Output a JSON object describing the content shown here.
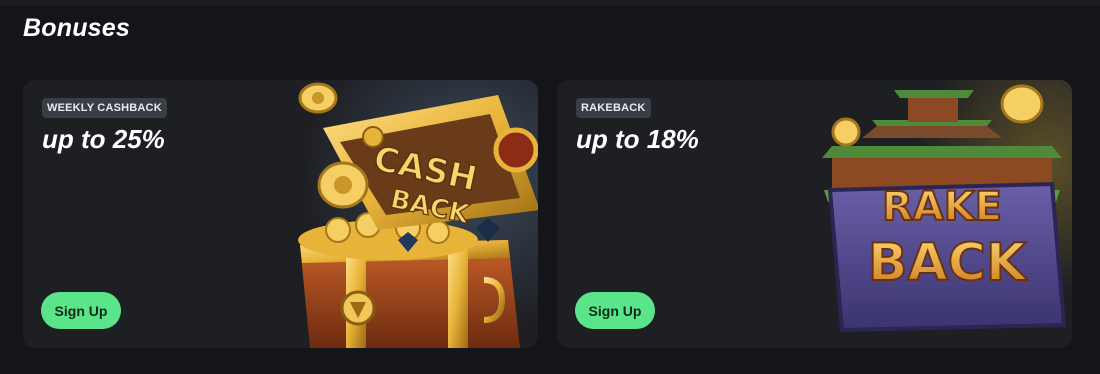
{
  "page": {
    "title": "Bonuses"
  },
  "cards": [
    {
      "badge": "WEEKLY CASHBACK",
      "headline": "up to 25%",
      "button": "Sign Up",
      "art_text": [
        "CASH",
        "BACK"
      ]
    },
    {
      "badge": "RAKEBACK",
      "headline": "up to 18%",
      "button": "Sign Up",
      "art_text": [
        "RAKE",
        "BACK"
      ]
    }
  ],
  "colors": {
    "background": "#141518",
    "card": "#1e1f23",
    "badge": "#3a3d46",
    "button": "#5be58a",
    "gold": "#e8b339"
  }
}
